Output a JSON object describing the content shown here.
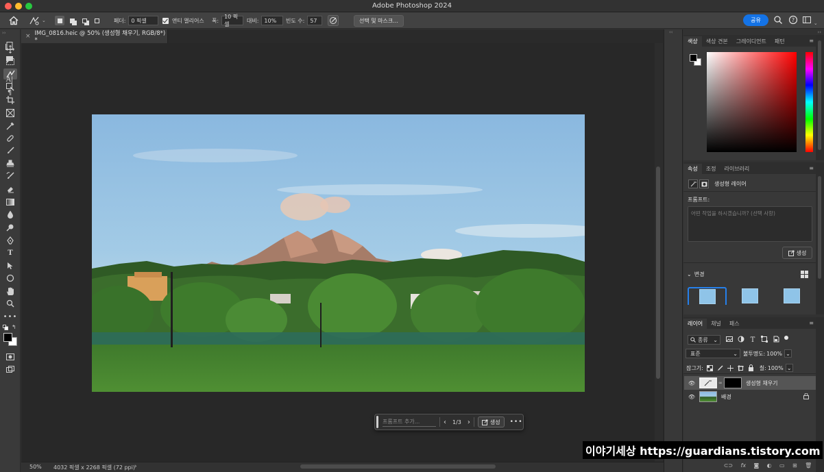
{
  "app": {
    "title": "Adobe Photoshop 2024"
  },
  "options_bar": {
    "feather_label": "페더:",
    "feather_value": "0 픽셀",
    "antialias_label": "앤티 앨리어스",
    "width_label": "폭:",
    "width_value": "10 픽셀",
    "contrast_label": "대비:",
    "contrast_value": "10%",
    "frequency_label": "빈도 수:",
    "frequency_value": "57",
    "select_mask_label": "선택 및 마스크...",
    "share_label": "공유"
  },
  "document": {
    "tab_title": "IMG_0816.heic @ 50% (생성형 채우기, RGB/8*) *",
    "zoom": "50%",
    "info": "4032 픽셀 x 2268 픽셀 (72 ppi)"
  },
  "context_bar": {
    "prompt_placeholder": "프롬프트 추가...",
    "page_indicator": "1/3",
    "generate_label": "생성"
  },
  "color_panel": {
    "tabs": [
      "색상",
      "색상 견본",
      "그레이디언트",
      "패턴"
    ],
    "active_tab": "색상"
  },
  "properties_panel": {
    "tabs": [
      "속성",
      "조정",
      "라이브러리"
    ],
    "layer_type": "생성형 레이어",
    "prompt_label": "프롬프트:",
    "prompt_placeholder": "어떤 작업을 하시겠습니까? (선택 사항)",
    "generate_label": "생성",
    "variations_label": "변경"
  },
  "layers_panel": {
    "tabs": [
      "레이어",
      "채널",
      "패스"
    ],
    "filter_label": "종류",
    "blend_mode": "표준",
    "opacity_label": "불투명도:",
    "opacity_value": "100%",
    "lock_label": "잠그기:",
    "fill_label": "칠:",
    "fill_value": "100%",
    "layers": [
      {
        "name": "생성형 채우기",
        "selected": true
      },
      {
        "name": "배경",
        "selected": false,
        "locked": true
      }
    ]
  },
  "watermark": "이야기세상 https://guardians.tistory.com"
}
